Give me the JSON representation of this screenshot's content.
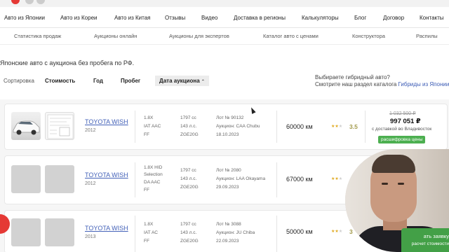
{
  "colors": {
    "accent_link": "#4361b8",
    "green": "#4caf50",
    "red": "#e53935"
  },
  "main_nav": [
    "Авто из Японии",
    "Авто из Кореи",
    "Авто из Китая",
    "Отзывы",
    "Видео",
    "Доставка в регионы",
    "Калькуляторы",
    "Блог",
    "Договор",
    "Контакты"
  ],
  "sub_nav": [
    "Статистика продаж",
    "Аукционы онлайн",
    "Аукционы для экспертов",
    "Каталог авто с ценами",
    "Конструктора",
    "Распилы"
  ],
  "intro_text": "Японские авто с аукциона без пробега по РФ.",
  "sort": {
    "label": "Сортировка",
    "items": [
      "Стоимость",
      "Год",
      "Пробег"
    ],
    "active": "Дата аукциона",
    "active_icon": "chevron-up-icon"
  },
  "hybrid": {
    "line1": "Выбираете гибридный авто?",
    "line2_prefix": "Смотрите наш раздел каталога ",
    "line2_link": "Гибриды из Японии"
  },
  "listings": [
    {
      "model": "TOYOTA WISH",
      "year": "2012",
      "spec1": "1.8X",
      "spec2": "IAT AAC",
      "spec3": "FF",
      "engine": "1797 cc",
      "power": "143 л.с.",
      "code": "ZGE20G",
      "lot": "Лот № 90132",
      "auction": "Аукцион: CAA Chubu",
      "date": "18.10.2023",
      "mileage": "60000 км",
      "stars_filled": 2,
      "stars_total": 3,
      "score": "3.5",
      "old_price": "1 032 500 ₽",
      "new_price": "997 051 ₽",
      "delivery": "с доставкой во Владивосток",
      "decode_label": "расшифровка цены"
    },
    {
      "model": "TOYOTA WISH",
      "year": "2012",
      "spec1": "1.8X HID",
      "spec1b": "Selection",
      "spec2": "DA AAC",
      "spec3": "FF",
      "engine": "1797 cc",
      "power": "143 л.с.",
      "code": "ZGE20G",
      "lot": "Лот № 2080",
      "auction": "Аукцион: LAA Okayama",
      "date": "29.09.2023",
      "mileage": "67000 км",
      "stars_filled": 2,
      "stars_total": 3
    },
    {
      "model": "TOYOTA WISH",
      "year": "2013",
      "spec1": "1.8X",
      "spec2": "IAT AC",
      "spec3": "FF",
      "engine": "1797 cc",
      "power": "143 л.с.",
      "code": "ZGE20G",
      "lot": "Лот № 3088",
      "auction": "Аукцион: JU Chiba",
      "date": "22.09.2023",
      "mileage": "50000 км",
      "stars_filled": 2,
      "stars_total": 3,
      "score": "3"
    }
  ],
  "cta": {
    "line1": "ать заявку",
    "line2": "расчет стоимости"
  }
}
